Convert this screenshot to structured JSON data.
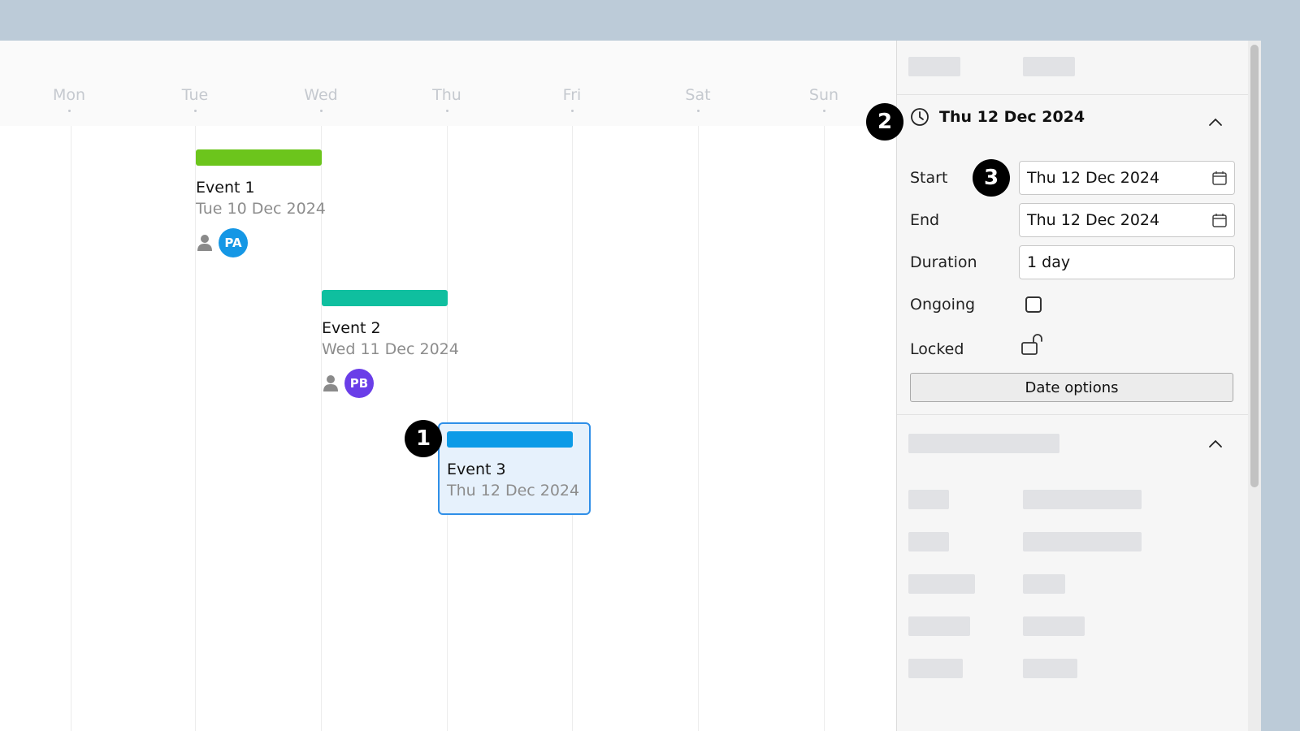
{
  "timeline": {
    "days": [
      "Mon",
      "Tue",
      "Wed",
      "Thu",
      "Fri",
      "Sat",
      "Sun"
    ],
    "events": [
      {
        "name": "Event 1",
        "date": "Tue 10 Dec 2024",
        "color": "#6cc51c",
        "assignee_initials": "PA",
        "assignee_color": "#1597e5"
      },
      {
        "name": "Event 2",
        "date": "Wed 11 Dec 2024",
        "color": "#0fbf9f",
        "assignee_initials": "PB",
        "assignee_color": "#6a3ee8"
      },
      {
        "name": "Event 3",
        "date": "Thu 12 Dec 2024",
        "color": "#0c9be7",
        "selected": true
      }
    ]
  },
  "markers": [
    "1",
    "2",
    "3"
  ],
  "panel": {
    "date_section": {
      "title": "Thu 12 Dec 2024",
      "icon": "clock-icon",
      "fields": {
        "start_label": "Start",
        "start_value": "Thu 12 Dec 2024",
        "end_label": "End",
        "end_value": "Thu 12 Dec 2024",
        "duration_label": "Duration",
        "duration_value": "1 day",
        "ongoing_label": "Ongoing",
        "ongoing_checked": false,
        "locked_label": "Locked",
        "locked": false
      },
      "date_options_label": "Date options"
    }
  }
}
